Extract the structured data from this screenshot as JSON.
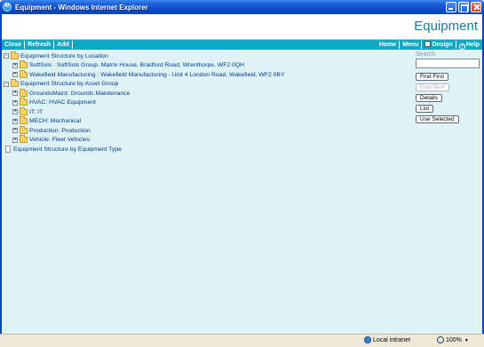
{
  "window": {
    "title": "Equipment - Windows Internet Explorer"
  },
  "header": {
    "title": "Equipment"
  },
  "toolbar": {
    "left": [
      "Close",
      "Refresh",
      "Add"
    ],
    "home": "Home",
    "menu": "Menu",
    "design": "Design",
    "help": "Help"
  },
  "tree": [
    {
      "label": "Equipment Structure by Location",
      "level": 0,
      "expander": "-",
      "icon": "folder-icon"
    },
    {
      "label": "SoftSols : SoftSols Group, Matrix House, Bradford Road, Wrenthorpe, WF2 0QH",
      "level": 1,
      "expander": "+",
      "icon": "folder-icon"
    },
    {
      "label": "Wakefield Manufacturing : Wakefield Manufacturing - Unit 4 London Road, Wakefield, WF2 0BY",
      "level": 1,
      "expander": "+",
      "icon": "folder-icon"
    },
    {
      "label": "Equipment Structure by Asset Group",
      "level": 0,
      "expander": "-",
      "icon": "folder-icon"
    },
    {
      "label": "GroundsMaint: Grounds Maintenance",
      "level": 1,
      "expander": "+",
      "icon": "folder-icon"
    },
    {
      "label": "HVAC: HVAC Equipment",
      "level": 1,
      "expander": "+",
      "icon": "folder-icon"
    },
    {
      "label": "IT: IT",
      "level": 1,
      "expander": "+",
      "icon": "folder-icon"
    },
    {
      "label": "MECH: Mechanical",
      "level": 1,
      "expander": "+",
      "icon": "folder-icon"
    },
    {
      "label": "Production: Production",
      "level": 1,
      "expander": "+",
      "icon": "folder-icon"
    },
    {
      "label": "Vehicle: Fleet Vehicles",
      "level": 1,
      "expander": "+",
      "icon": "folder-icon"
    },
    {
      "label": "Equipment Structure by Equipment Type",
      "level": 0,
      "expander": "",
      "icon": "document-icon"
    }
  ],
  "panel": {
    "search_label": "Search",
    "search_value": "",
    "find_first": "Find First",
    "find_next": "Find Next",
    "details": "Details",
    "list": "List",
    "use_selected": "Use Selected"
  },
  "statusbar": {
    "zone": "Local intranet",
    "zoom": "100%"
  },
  "colors": {
    "toolbar_bg": "#0fa8c4",
    "content_bg": "#dff3f6",
    "title_color": "#1a7aa0",
    "link_color": "#003a8a"
  }
}
